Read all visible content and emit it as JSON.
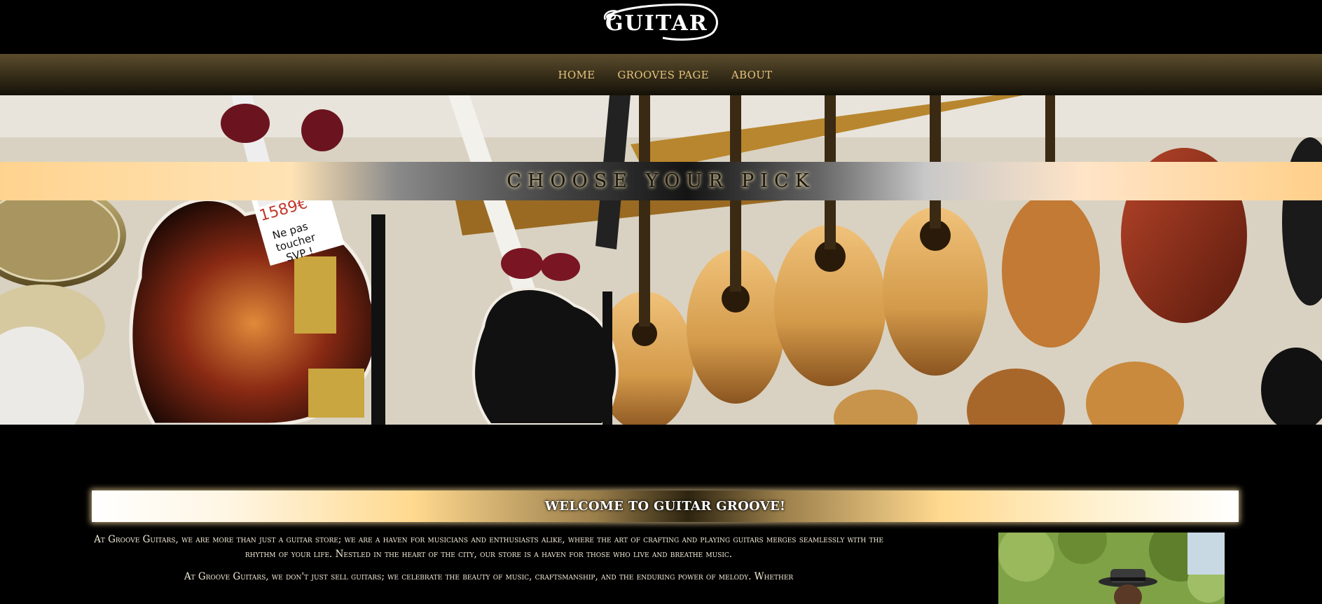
{
  "logo": {
    "text": "GUITAR"
  },
  "nav": {
    "items": [
      {
        "label": "HOME"
      },
      {
        "label": "GROOVES PAGE"
      },
      {
        "label": "ABOUT"
      }
    ]
  },
  "hero": {
    "title": "CHOOSE YOUR PICK",
    "sign_price": "1589€",
    "sign_text": "Ne pas toucher SVP !"
  },
  "welcome": {
    "title": "WELCOME TO GUITAR GROOVE!",
    "paragraphs": [
      "At Groove Guitars, we are more than just a guitar store; we are a haven for musicians and enthusiasts alike, where the art of crafting and playing guitars merges seamlessly with the rhythm of your life. Nestled in the heart of the city, our store is a haven for those who live and breathe music.",
      "At Groove Guitars, we don't just sell guitars; we celebrate the beauty of music, craftsmanship, and the enduring power of melody. Whether"
    ]
  },
  "colors": {
    "nav_text": "#e4c27c",
    "background": "#000000",
    "gold_accent": "#ffd98f"
  }
}
